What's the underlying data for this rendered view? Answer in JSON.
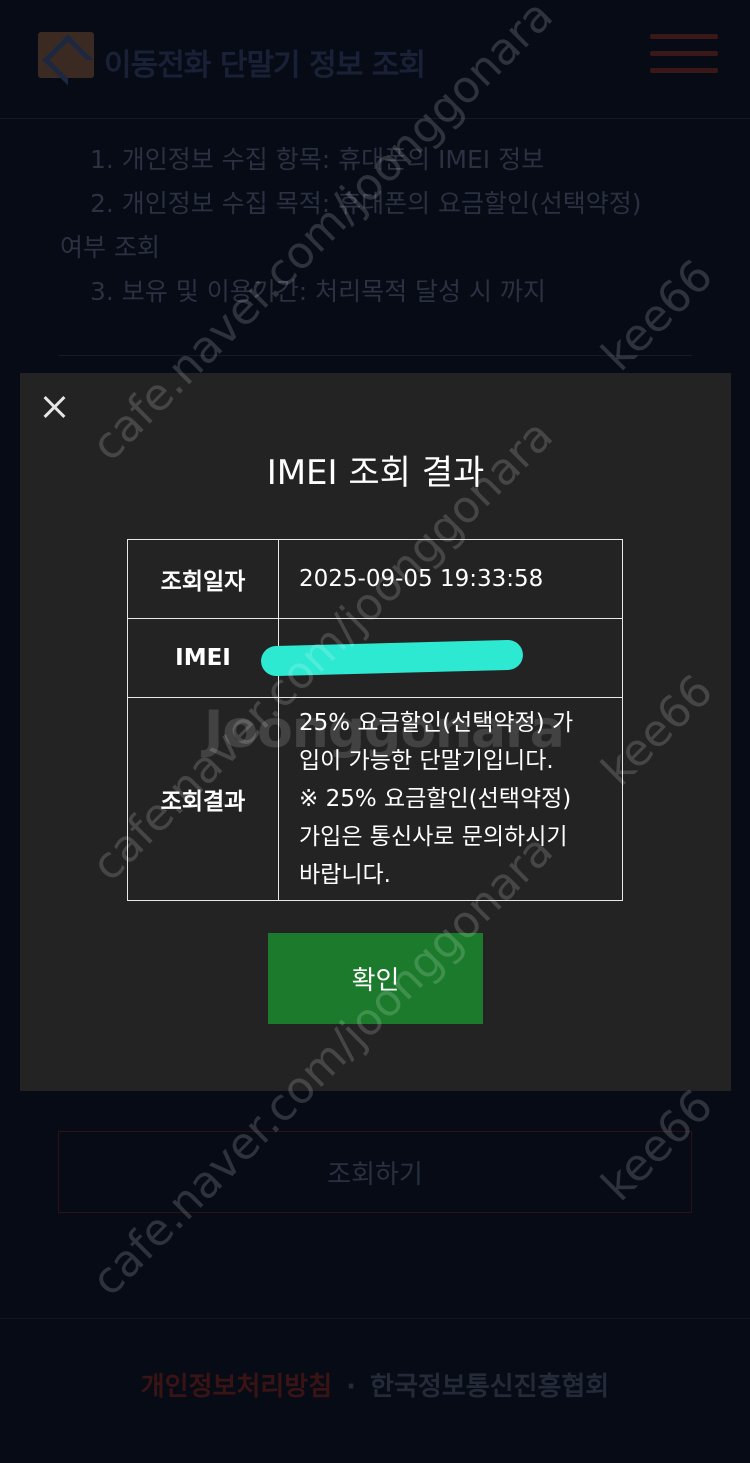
{
  "header": {
    "logo_text": "이동전화 단말기 정보 조회"
  },
  "consent": {
    "line1": "1. 개인정보 수집 항목: 휴대폰의 IMEI 정보",
    "line2a": "2. 개인정보 수집 목적: 휴대폰의 요금할인(선택약정)",
    "line2b": "여부 조회",
    "line3": "3. 보유 및 이용기간: 처리목적 달성 시 까지"
  },
  "search_button_label": "조회하기",
  "footer": {
    "privacy_link": "개인정보처리방침",
    "separator": "·",
    "org_name": "한국정보통신진흥협회"
  },
  "modal": {
    "title": "IMEI 조회 결과",
    "rows": [
      {
        "label": "조회일자",
        "value": "2025-09-05 19:33:58"
      },
      {
        "label": "IMEI",
        "value": ""
      },
      {
        "label": "조회결과",
        "value_lines": [
          "25% 요금할인(선택약정) 가",
          "입이 가능한 단말기입니다.",
          "※ 25% 요금할인(선택약정)",
          "가입은 통신사로 문의하시기",
          "바랍니다."
        ]
      }
    ],
    "confirm_label": "확인"
  },
  "watermarks": {
    "site": "cafe.naver.com/joonggonara",
    "user": "kee66",
    "brand": "Joonggonara"
  },
  "colors": {
    "modal_bg": "#232323",
    "confirm_green": "#1b7a2c",
    "redact_cyan": "#2ee9d2",
    "page_bg": "#060b16"
  }
}
